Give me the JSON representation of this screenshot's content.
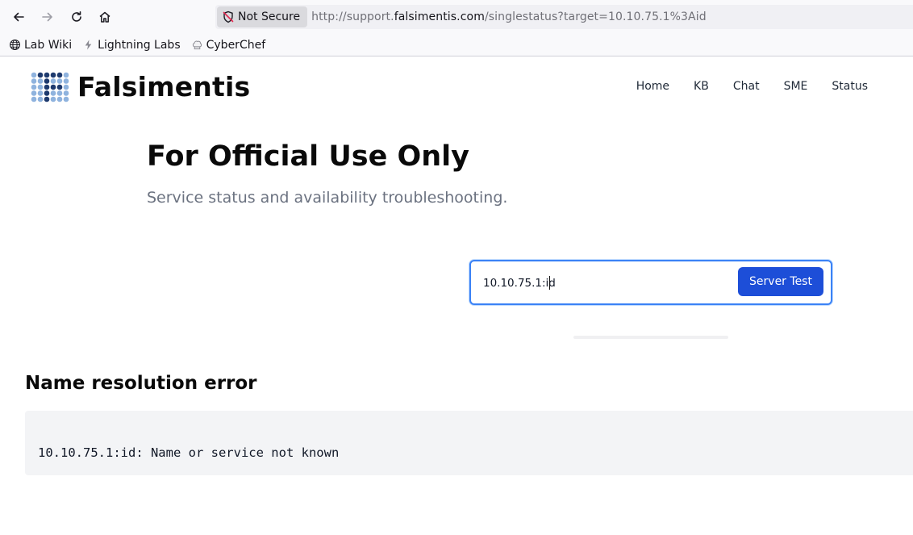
{
  "browser": {
    "security_label": "Not Secure",
    "url_prefix": "http://support.",
    "url_host": "falsimentis.com",
    "url_path": "/singlestatus?target=10.10.75.1%3Aid"
  },
  "bookmarks": [
    {
      "label": "Lab Wiki",
      "icon": "globe-icon"
    },
    {
      "label": "Lightning Labs",
      "icon": "lightning-icon"
    },
    {
      "label": "CyberChef",
      "icon": "chef-hat-icon"
    }
  ],
  "site": {
    "brand": "Falsimentis",
    "nav": [
      "Home",
      "KB",
      "Chat",
      "SME",
      "Status"
    ]
  },
  "hero": {
    "title": "For Official Use Only",
    "subtitle": "Service status and availability troubleshooting."
  },
  "form": {
    "input_value": "10.10.75.1:id",
    "button_label": "Server Test"
  },
  "result": {
    "heading": "Name resolution error",
    "output": "10.10.75.1:id: Name or service not known"
  },
  "colors": {
    "accent": "#1d4ed8",
    "focus_ring": "#3b82f6",
    "logo_dark": "#1e3a6e",
    "logo_light": "#8fb3de"
  }
}
